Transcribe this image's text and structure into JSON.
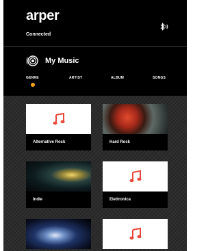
{
  "header": {
    "brand": "arper",
    "status": "Connected",
    "bluetooth_icon": "bluetooth-icon"
  },
  "music": {
    "title": "My Music",
    "icon": "speaker-icon",
    "tabs": [
      "GENRE",
      "ARTIST",
      "ALBUM",
      "SONGS"
    ],
    "active_tab": "GENRE",
    "accent": "#f2a01b",
    "note_color": "#e8483a"
  },
  "genres": [
    {
      "label": "Alternative Rock",
      "art": "music-note-icon"
    },
    {
      "label": "Hard Rock",
      "art": "red-abstract-image"
    },
    {
      "label": "Indie",
      "art": "green-gold-abstract-image"
    },
    {
      "label": "Elettronica",
      "art": "music-note-icon"
    },
    {
      "label": "",
      "art": "blue-abstract-image"
    },
    {
      "label": "",
      "art": "music-note-icon"
    }
  ]
}
